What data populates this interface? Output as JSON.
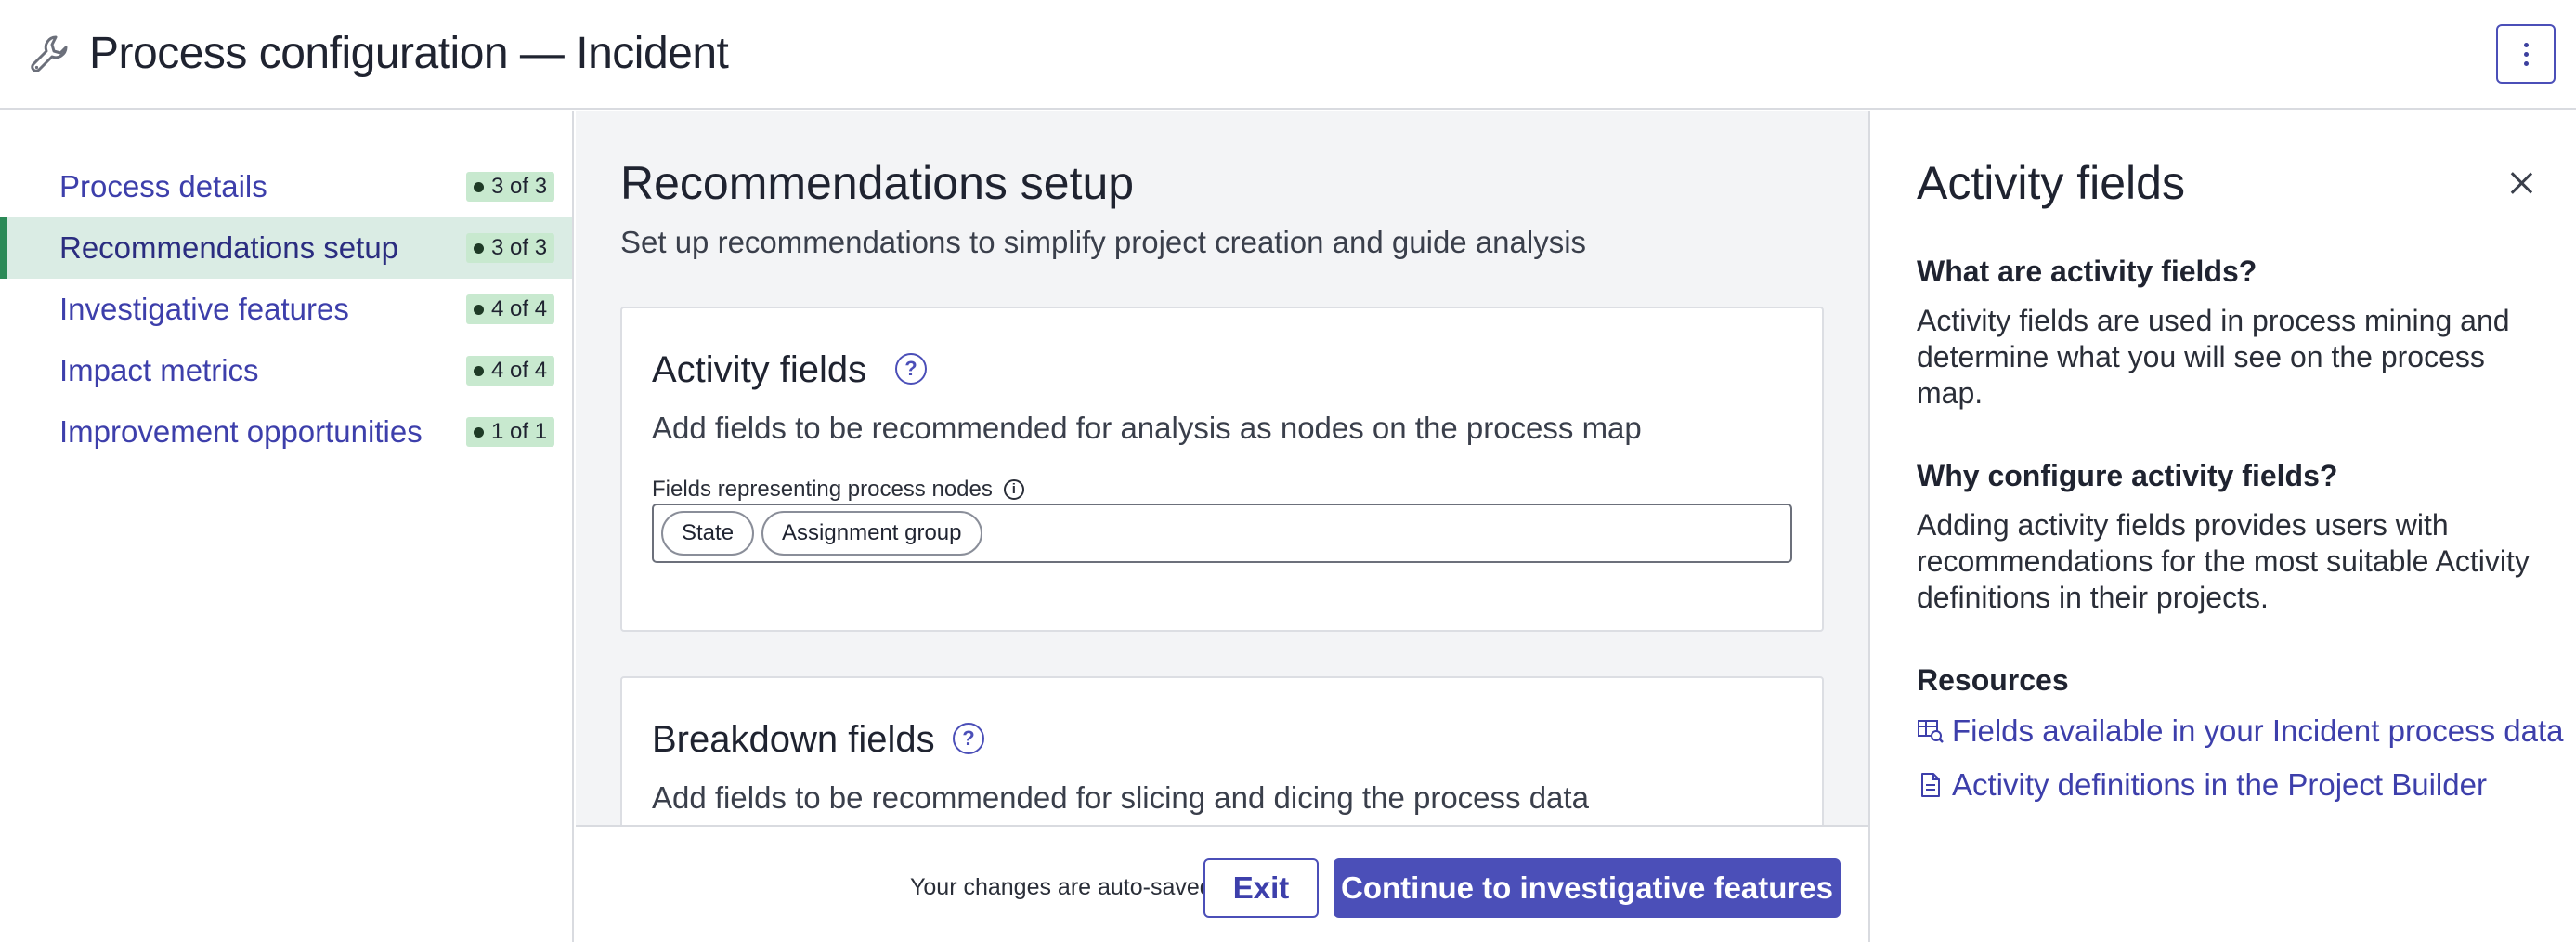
{
  "header": {
    "title": "Process configuration — Incident",
    "icon": "wrench-icon",
    "more_icon": "more-vertical-icon"
  },
  "sidebar": {
    "items": [
      {
        "label": "Process details",
        "badge": "3 of 3",
        "active": false
      },
      {
        "label": "Recommendations setup",
        "badge": "3 of 3",
        "active": true
      },
      {
        "label": "Investigative features",
        "badge": "4 of 4",
        "active": false
      },
      {
        "label": "Impact metrics",
        "badge": "4 of 4",
        "active": false
      },
      {
        "label": "Improvement opportunities",
        "badge": "1 of 1",
        "active": false
      }
    ]
  },
  "main": {
    "title": "Recommendations setup",
    "subtitle": "Set up recommendations to simplify project creation and guide analysis",
    "activity_card": {
      "title": "Activity fields",
      "description": "Add fields to be recommended for analysis as nodes on the process map",
      "field_label": "Fields representing process nodes",
      "chips": [
        "State",
        "Assignment group"
      ]
    },
    "breakdown_card": {
      "title": "Breakdown fields",
      "description": "Add fields to be recommended for slicing and dicing the process data"
    }
  },
  "footer": {
    "autosave_text": "Your changes are auto-saved",
    "exit_label": "Exit",
    "continue_label": "Continue to investigative features"
  },
  "panel": {
    "title": "Activity fields",
    "q1": "What are activity fields?",
    "a1": "Activity fields are used in process mining and determine what you will see on the process map.",
    "q2": "Why configure activity fields?",
    "a2": "Adding activity fields provides users with recommendations for the most suitable Activity definitions in their projects.",
    "resources_heading": "Resources",
    "links": [
      {
        "label": "Fields available in your Incident process data",
        "icon": "table-search-icon"
      },
      {
        "label": "Activity definitions in the Project Builder",
        "icon": "document-icon"
      }
    ]
  },
  "colors": {
    "accent": "#4b4fb8",
    "link": "#3d3fab",
    "active_nav_bg": "#daece4",
    "active_nav_bar": "#2b8a57",
    "badge_bg": "#c8e9cf"
  }
}
